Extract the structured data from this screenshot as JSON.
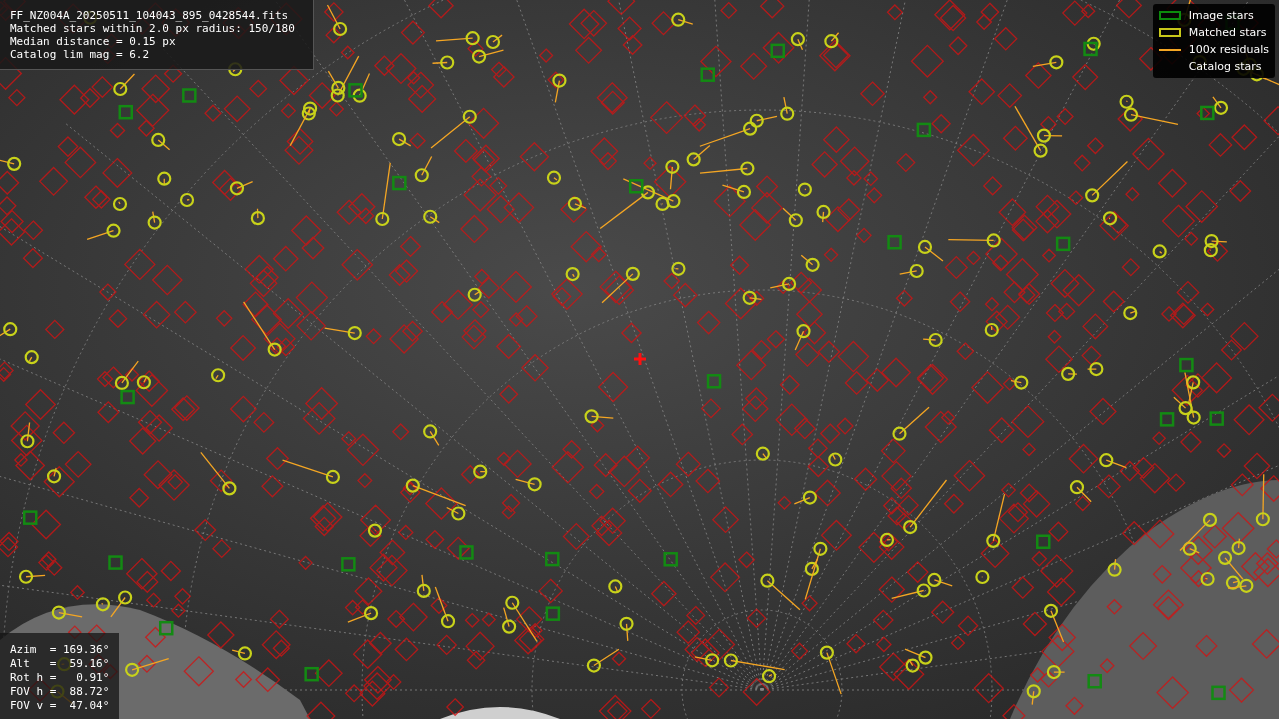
{
  "info_panel": {
    "lines": [
      "FF_NZ004A_20250511_104043_895_0428544.fits",
      "Matched stars within 2.0 px radius: 150/180",
      "Median distance = 0.15 px",
      "Catalog lim mag = 6.2"
    ]
  },
  "legend": {
    "items": [
      {
        "kind": "image",
        "label": "Image stars"
      },
      {
        "kind": "matched",
        "label": "Matched stars"
      },
      {
        "kind": "residual",
        "label": "100x residuals"
      },
      {
        "kind": "catalog",
        "label": "Catalog stars"
      }
    ]
  },
  "pointing_panel": {
    "lines": [
      "Azim  = 169.36°",
      "Alt   =  59.16°",
      "Rot h =   0.91°",
      "FOV h =  88.72°",
      "FOV v =  47.04°"
    ]
  }
}
